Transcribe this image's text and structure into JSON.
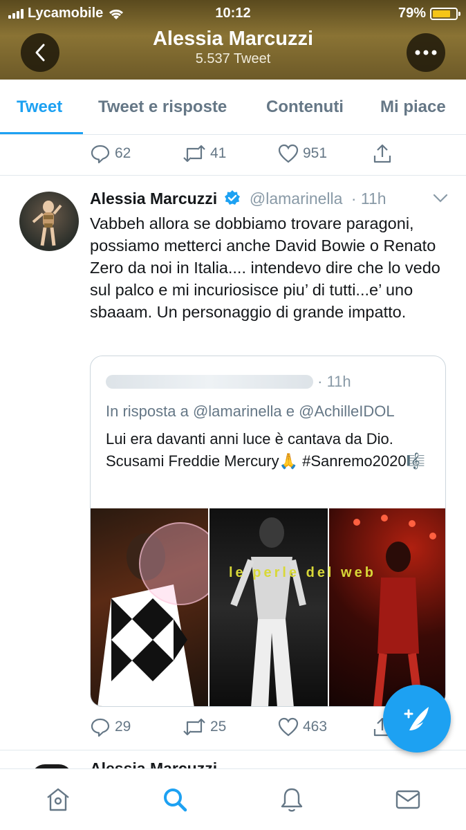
{
  "status_bar": {
    "carrier": "Lycamobile",
    "time": "10:12",
    "battery": "79%",
    "battery_level": 0.79
  },
  "header": {
    "title": "Alessia Marcuzzi",
    "subtitle": "5.537 Tweet",
    "back_icon": "chevron-left-icon",
    "more_icon": "more-dots-icon"
  },
  "tabs": [
    {
      "label": "Tweet",
      "active": true
    },
    {
      "label": "Tweet e risposte",
      "active": false
    },
    {
      "label": "Contenuti",
      "active": false
    },
    {
      "label": "Mi piace",
      "active": false
    }
  ],
  "prev_tweet_actions": {
    "replies": "62",
    "retweets": "41",
    "likes": "951"
  },
  "tweet": {
    "name": "Alessia Marcuzzi",
    "handle": "@lamarinella",
    "time": "· 11h",
    "text": "Vabbeh allora se dobbiamo trovare paragoni, possiamo metterci anche  David Bowie o Renato Zero da noi in Italia.... intendevo dire che lo vedo sul palco e mi incuriosisce piu’ di tutti...e’ uno sbaaam. Un personaggio di grande impatto.",
    "quote": {
      "head": "· 11h",
      "reply_to": "In risposta a @lamarinella e @AchilleIDOL",
      "text": "Lui era davanti anni luce è cantava da Dio. Scusami Freddie Mercury🙏 #Sanremo2020🎼",
      "watermark": "le perle del web"
    },
    "actions": {
      "replies": "29",
      "retweets": "25",
      "likes": "463"
    }
  },
  "next_tweet": {
    "name": "Alessia Marcuzzi"
  },
  "fab": {
    "icon": "compose-tweet-icon"
  },
  "bottom_nav": [
    {
      "name": "home-icon",
      "active": false
    },
    {
      "name": "search-icon",
      "active": true
    },
    {
      "name": "notifications-icon",
      "active": false
    },
    {
      "name": "messages-icon",
      "active": false
    }
  ],
  "colors": {
    "accent": "#1da1f2",
    "muted": "#657786",
    "header_gold": "#8a7334"
  }
}
